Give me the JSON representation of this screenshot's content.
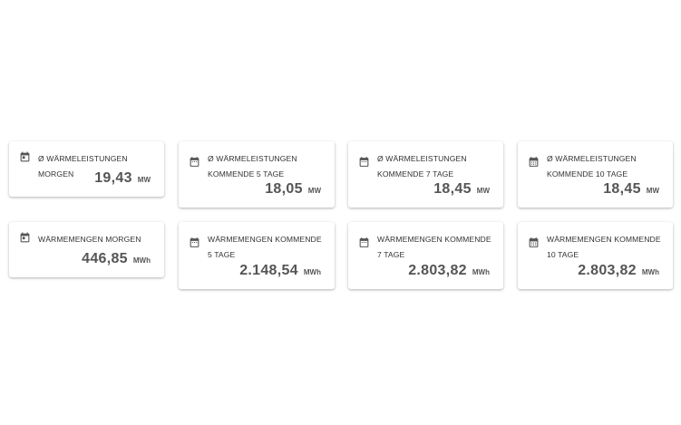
{
  "cards": [
    {
      "label": "Ø Wärmeleistungen morgen",
      "value": "19,43",
      "unit": "MW",
      "icon": "calendar-today-icon"
    },
    {
      "label": "Ø Wärmeleistungen kommende 5 Tage",
      "value": "18,05",
      "unit": "MW",
      "icon": "calendar-icon"
    },
    {
      "label": "Ø Wärmeleistungen kommende 7 Tage",
      "value": "18,45",
      "unit": "MW",
      "icon": "calendar-icon"
    },
    {
      "label": "Ø Wärmeleistungen kommende 10 Tage",
      "value": "18,45",
      "unit": "MW",
      "icon": "calendar-month-icon"
    },
    {
      "label": "Wärmemengen morgen",
      "value": "446,85",
      "unit": "MWh",
      "icon": "calendar-today-icon"
    },
    {
      "label": "Wärmemengen kommende 5 Tage",
      "value": "2.148,54",
      "unit": "MWh",
      "icon": "calendar-icon"
    },
    {
      "label": "Wärmemengen kommende 7 Tage",
      "value": "2.803,82",
      "unit": "MWh",
      "icon": "calendar-icon"
    },
    {
      "label": "Wärmemengen kommende 10 Tage",
      "value": "2.803,82",
      "unit": "MWh",
      "icon": "calendar-month-icon"
    }
  ],
  "colors": {
    "icon": "#555555",
    "text": "#333333",
    "value": "#555555"
  }
}
